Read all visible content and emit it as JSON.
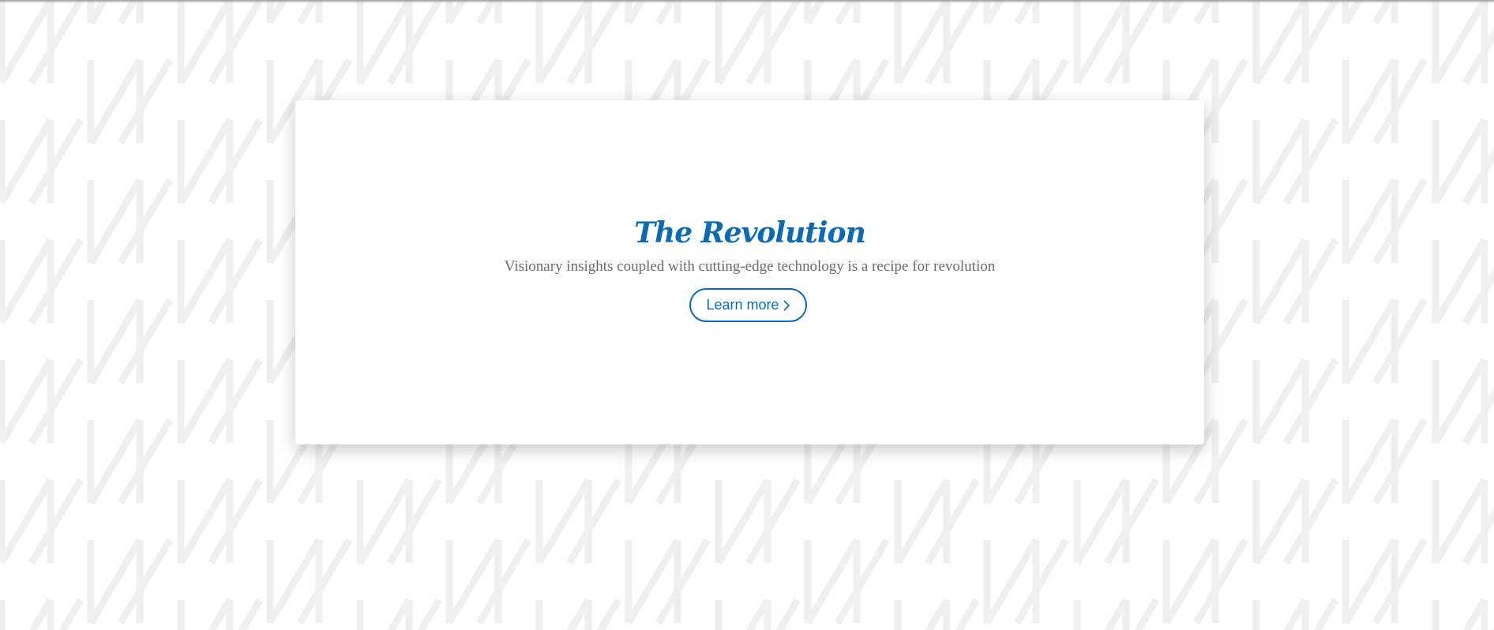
{
  "hero": {
    "title": "The Revolution",
    "subtitle": "Visionary insights coupled with cutting-edge technology is a recipe for revolution",
    "cta_label": "Learn more",
    "cta_icon": "chevron-right-icon"
  },
  "colors": {
    "accent": "#0a6ab6",
    "subtitle_text": "#6b6b6b",
    "background": "#ffffff",
    "pattern": "#efefef",
    "card": "#ffffff"
  }
}
